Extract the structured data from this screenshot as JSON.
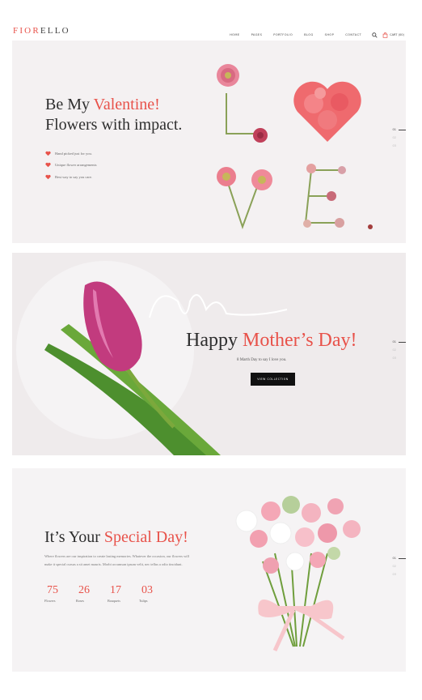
{
  "header": {
    "logo_prefix": "FIOR",
    "logo_suffix": "ELLO",
    "nav": [
      "Home",
      "Pages",
      "Portfolio",
      "Blog",
      "Shop",
      "Contact"
    ],
    "cart_label": "CART (00)"
  },
  "panel1": {
    "title_line1_plain": "Be My ",
    "title_line1_accent": "Valentine!",
    "title_line2": "Flowers with impact.",
    "features": [
      "Hand picked just for you.",
      "Unique flower arrangements",
      "Best way to say you care."
    ],
    "nav": [
      "01",
      "02",
      "03"
    ]
  },
  "panel2": {
    "script_word": "Mom",
    "title_plain": "Happy ",
    "title_accent": "Mother’s Day!",
    "subtitle": "8 Marth Day to say I love you.",
    "button": "View Collection",
    "nav": [
      "01",
      "02",
      "03"
    ]
  },
  "panel3": {
    "title_plain": "It’s Your ",
    "title_accent": "Special Day!",
    "description": "Where flowers are our inspiration to create lasting memories. Whatever the occasion, our flowers will make it special cursus a sit amet mauris. Morbi accumsan ipsum velit, nec tellus a odio tincidunt.",
    "stats": [
      {
        "value": "75",
        "label": "Flowers"
      },
      {
        "value": "26",
        "label": "Roses"
      },
      {
        "value": "17",
        "label": "Bouquets"
      },
      {
        "value": "03",
        "label": "Tulips"
      }
    ],
    "nav": [
      "01",
      "02",
      "03"
    ]
  },
  "colors": {
    "accent": "#e8524a",
    "dark": "#2e2e2e",
    "button": "#111111"
  },
  "icons": {
    "search": "search-icon",
    "cart": "cart-icon",
    "bullet": "heart-icon"
  }
}
